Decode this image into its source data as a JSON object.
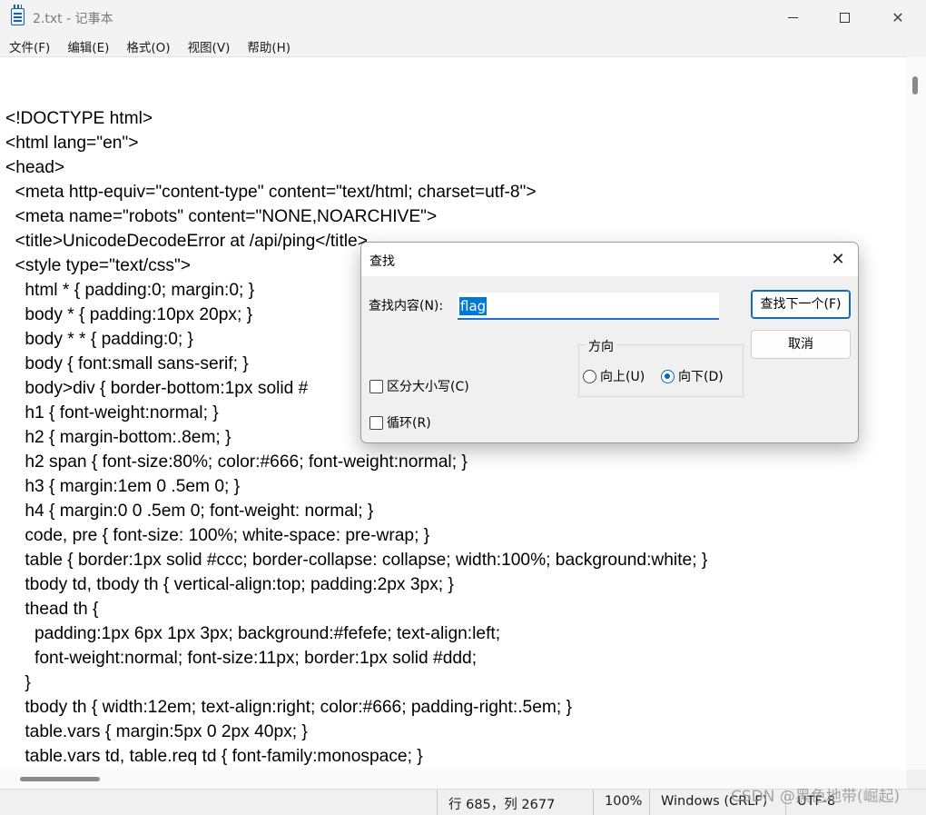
{
  "window": {
    "title": "2.txt - 记事本",
    "close_glyph": "✕"
  },
  "menu": {
    "items": [
      "文件(F)",
      "编辑(E)",
      "格式(O)",
      "视图(V)",
      "帮助(H)"
    ]
  },
  "editor": {
    "lines": [
      "<!DOCTYPE html>",
      "<html lang=\"en\">",
      "<head>",
      "  <meta http-equiv=\"content-type\" content=\"text/html; charset=utf-8\">",
      "  <meta name=\"robots\" content=\"NONE,NOARCHIVE\">",
      "  <title>UnicodeDecodeError at /api/ping</title>",
      "  <style type=\"text/css\">",
      "    html * { padding:0; margin:0; }",
      "    body * { padding:10px 20px; }",
      "    body * * { padding:0; }",
      "    body { font:small sans-serif; }",
      "    body>div { border-bottom:1px solid #",
      "    h1 { font-weight:normal; }",
      "    h2 { margin-bottom:.8em; }",
      "    h2 span { font-size:80%; color:#666; font-weight:normal; }",
      "    h3 { margin:1em 0 .5em 0; }",
      "    h4 { margin:0 0 .5em 0; font-weight: normal; }",
      "    code, pre { font-size: 100%; white-space: pre-wrap; }",
      "    table { border:1px solid #ccc; border-collapse: collapse; width:100%; background:white; }",
      "    tbody td, tbody th { vertical-align:top; padding:2px 3px; }",
      "    thead th {",
      "      padding:1px 6px 1px 3px; background:#fefefe; text-align:left;",
      "      font-weight:normal; font-size:11px; border:1px solid #ddd;",
      "    }",
      "    tbody th { width:12em; text-align:right; color:#666; padding-right:.5em; }",
      "    table.vars { margin:5px 0 2px 40px; }",
      "    table.vars td, table.req td { font-family:monospace; }"
    ]
  },
  "find_dialog": {
    "title": "查找",
    "close_glyph": "✕",
    "find_label": "查找内容(N):",
    "find_value": "flag",
    "find_next_label": "查找下一个(F)",
    "cancel_label": "取消",
    "direction_label": "方向",
    "up_label": "向上(U)",
    "down_label": "向下(D)",
    "direction_selected": "down",
    "match_case_label": "区分大小写(C)",
    "match_case_checked": false,
    "wrap_around_label": "循环(R)",
    "wrap_around_checked": false
  },
  "status": {
    "position": "行 685，列 2677",
    "zoom": "100%",
    "line_ending": "Windows (CRLF)",
    "encoding": "UTF-8"
  },
  "watermark": "CSDN @黑色地带(崛起)"
}
